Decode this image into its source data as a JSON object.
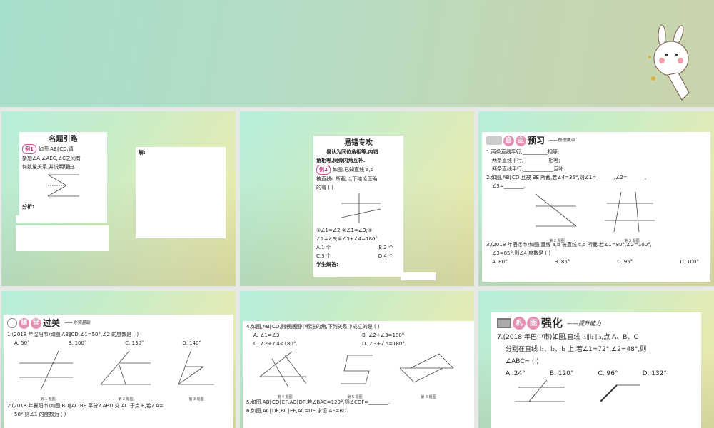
{
  "slides": [
    {
      "title": "名题引路",
      "badge": "例1",
      "lines": [
        "如图,AB∥CD,请",
        "猜想∠A,∠AEC,∠C之间有",
        "何数量关系,并说明理由."
      ],
      "analysis": "分析:",
      "solution": "解:"
    },
    {
      "title": "易错专攻",
      "lines": [
        "易认为同位角相等,内错",
        "角相等,同旁内角互补."
      ],
      "badge": "例2",
      "q": [
        "如图,已知直线 a,b",
        "被直线c 所截,以下结论正确",
        "的有 ( )"
      ],
      "stmts": [
        "①∠1=∠2;②∠1=∠3;③",
        "∠2=∠3;④∠3+∠4=180°."
      ],
      "opts": [
        "A.1 个",
        "B.2 个",
        "C.3 个",
        "D.4 个"
      ],
      "answer": "学生解答:"
    },
    {
      "c1": "自",
      "c2": "主",
      "big": "预习",
      "sub": "——梳理要点",
      "lines": [
        "1.两条直线平行,__________相等;",
        "两条直线平行,__________相等;",
        "两条直线平行,____________互补.",
        "2.如图,AB∥CD 且被 BE 所截,若∠4=35°,则∠1=_______,∠2=_______,",
        "∠3=________."
      ],
      "fig2": "第 2 题图",
      "fig3": "第 3 题图",
      "q3": [
        "3.(2018 年宿迁市)如图,直线 a,b 被直线 c,d 所截,若∠1=80°,∠2=100°,",
        "∠3=85°,则∠4 度数是 ( )"
      ],
      "opts": [
        "A. 80°",
        "B. 85°",
        "C. 95°",
        "D. 100°"
      ]
    },
    {
      "c1": "随",
      "c2": "堂",
      "big": "过关",
      "sub": "——夯实基础",
      "q1": "1.(2018 年沈阳市)如图,AB∥CD,∠1=50°,∠2 的度数是 ( )",
      "opts": [
        "A. 50°",
        "B. 100°",
        "C. 130°",
        "D. 140°"
      ],
      "figs": [
        "第 1 题图",
        "第 2 题图",
        "第 3 题图"
      ],
      "q2": [
        "2.(2018 年襄阳市)如图,BD∥AC,BE 平分∠ABD,交 AC 于点 E,若∠A=",
        "50°,则∠1 的度数为 ( )"
      ]
    },
    {
      "q4": "4.如图,AB∥CD,则根据图中标注的角,下列关系中成立的是 ( )",
      "opts": [
        "A. ∠1=∠3",
        "B. ∠2+∠3=180°",
        "C. ∠2+∠4<180°",
        "D. ∠3+∠5=180°"
      ],
      "figs": [
        "第 4 题图",
        "第 5 题图",
        "第 6 题图"
      ],
      "q5": "5.如图,AB∥CD∥EF,AC∥DF,若∠BAC=120°,则∠CDF=________.",
      "q6": "6.如图,AC∥DE,BC∥EF,AC=DE.求证:AF=BD."
    },
    {
      "c1": "巩",
      "c2": "固",
      "big": "强化",
      "sub": "——提升能力",
      "lines": [
        "7.(2018 年巴中市)如图,直线 l₁∥l₂∥l₃,点 A、B、C",
        "分别在直线 l₁、l₂、l₃ 上,若∠1=72°,∠2=48°,则",
        "∠ABC= ( )"
      ],
      "opts": [
        "A. 24°",
        "B. 120°",
        "C. 96°",
        "D. 132°"
      ]
    }
  ]
}
